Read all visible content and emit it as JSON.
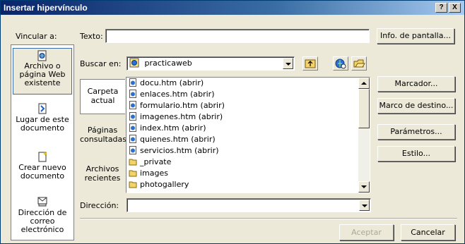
{
  "window": {
    "title": "Insertar hipervínculo",
    "help_btn": "?",
    "close_btn": "X"
  },
  "link_to": {
    "label": "Vincular a:",
    "items": [
      {
        "line1": "Archivo o",
        "line2": "página Web",
        "line3": "existente",
        "icon": "web-page-icon",
        "selected": true
      },
      {
        "line1": "Lugar de este",
        "line2": "documento",
        "icon": "place-in-document-icon",
        "selected": false
      },
      {
        "line1": "Crear nuevo",
        "line2": "documento",
        "icon": "new-document-icon",
        "selected": false
      },
      {
        "line1": "Dirección de",
        "line2": "correo",
        "line3": "electrónico",
        "icon": "email-icon",
        "selected": false
      }
    ]
  },
  "text": {
    "label": "Texto:",
    "value": ""
  },
  "screen_tip_button": "Info. de pantalla...",
  "look_in": {
    "label": "Buscar en:",
    "value": "practicaweb",
    "icon": "globe-folder-icon"
  },
  "toolbar_icons": [
    "up-folder-icon",
    "browse-web-icon",
    "browse-file-icon"
  ],
  "middle_tabs": [
    {
      "line1": "Carpeta",
      "line2": "actual",
      "selected": true
    },
    {
      "line1": "Páginas",
      "line2": "consultadas",
      "selected": false
    },
    {
      "line1": "Archivos",
      "line2": "recientes",
      "selected": false
    }
  ],
  "files": [
    {
      "name": "docu.htm (abrir)",
      "icon": "html-file-icon"
    },
    {
      "name": "enlaces.htm (abrir)",
      "icon": "html-file-icon"
    },
    {
      "name": "formulario.htm (abrir)",
      "icon": "html-file-icon"
    },
    {
      "name": "imagenes.htm (abrir)",
      "icon": "html-file-icon"
    },
    {
      "name": "index.htm (abrir)",
      "icon": "html-file-icon"
    },
    {
      "name": "quienes.htm (abrir)",
      "icon": "html-file-icon"
    },
    {
      "name": "servicios.htm (abrir)",
      "icon": "html-file-icon"
    },
    {
      "name": "_private",
      "icon": "folder-icon"
    },
    {
      "name": "images",
      "icon": "folder-icon"
    },
    {
      "name": "photogallery",
      "icon": "folder-icon"
    }
  ],
  "address": {
    "label": "Dirección:",
    "value": ""
  },
  "right_buttons": [
    "Marcador...",
    "Marco de destino...",
    "Parámetros...",
    "Estilo..."
  ],
  "accept_button": "Aceptar",
  "cancel_button": "Cancelar",
  "colors": {
    "titlebar": "#0a246a",
    "dialog_bg": "#ece9d8"
  }
}
